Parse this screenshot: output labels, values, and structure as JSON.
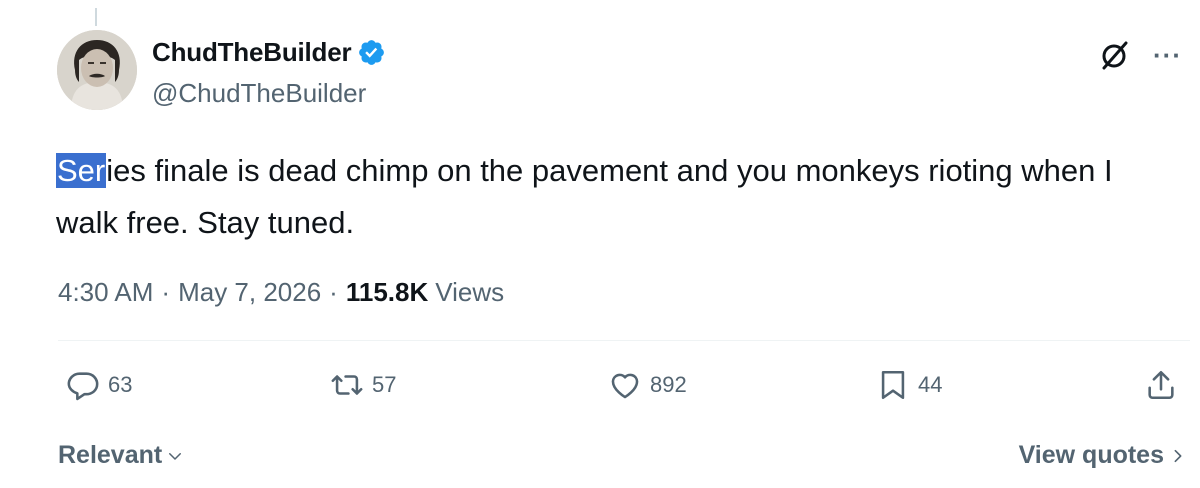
{
  "author": {
    "display_name": "ChudTheBuilder",
    "handle": "@ChudTheBuilder",
    "verified": true
  },
  "tweet": {
    "text_selected": "Ser",
    "text_rest": "ies finale is dead chimp on the pavement and you monkeys rioting when I walk free. Stay tuned."
  },
  "meta": {
    "time": "4:30 AM",
    "separator": "·",
    "date": "May 7, 2026",
    "views_count": "115.8K",
    "views_label": "Views"
  },
  "actions": {
    "replies": "63",
    "reposts": "57",
    "likes": "892",
    "bookmarks": "44"
  },
  "footer": {
    "sort_label": "Relevant",
    "quotes_label": "View quotes"
  },
  "colors": {
    "text": "#0f1419",
    "secondary": "#536471",
    "verified_blue": "#1d9bf0",
    "selection": "#3a6fcf"
  }
}
